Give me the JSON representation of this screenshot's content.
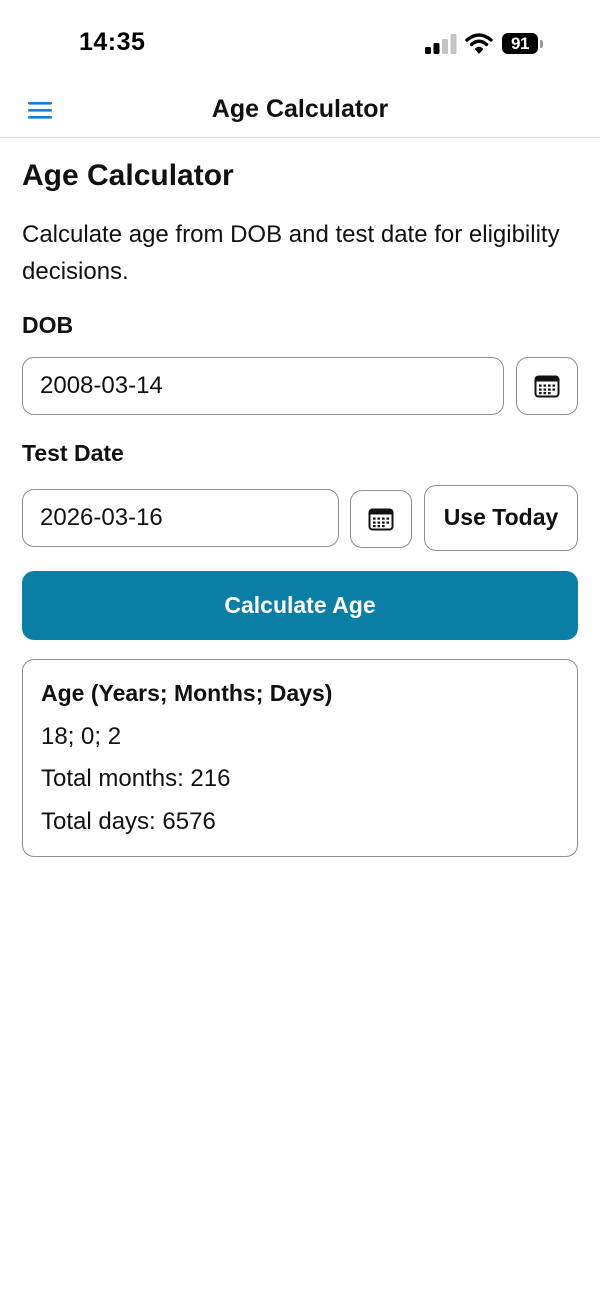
{
  "status_bar": {
    "time": "14:35",
    "battery": "91",
    "icons": [
      "signal-icon",
      "wifi-icon",
      "battery-icon"
    ]
  },
  "nav": {
    "title": "Age Calculator",
    "menu_icon": "menu-icon"
  },
  "page": {
    "title": "Age Calculator",
    "description": "Calculate age from DOB and test date for eligibility decisions."
  },
  "form": {
    "dob": {
      "label": "DOB",
      "value": "2008-03-14",
      "picker_icon": "calendar-icon"
    },
    "test_date": {
      "label": "Test Date",
      "value": "2026-03-16",
      "picker_icon": "calendar-icon",
      "use_today_label": "Use Today"
    },
    "calculate_label": "Calculate Age"
  },
  "result": {
    "heading": "Age (Years; Months; Days)",
    "ymd": "18; 0; 2",
    "total_months": "Total months: 216",
    "total_days": "Total days: 6576"
  },
  "colors": {
    "accent": "#0b7ea5",
    "menu_icon": "#1a7fd4",
    "border": "#8e8e8e"
  }
}
